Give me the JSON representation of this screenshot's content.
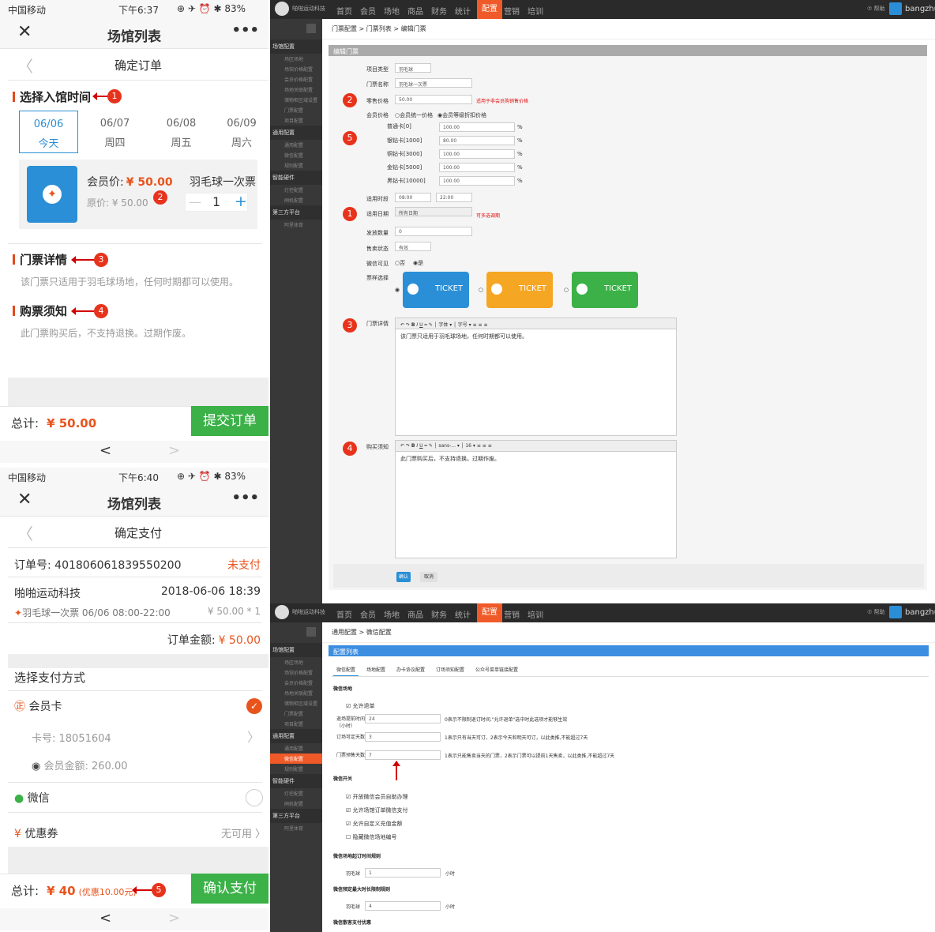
{
  "order_screen": {
    "status": {
      "carrier": "中国移动",
      "time": "下午6:37",
      "icons": "⊕ ✈ ⏰ ✱ 83%"
    },
    "wechat_title": "场馆列表",
    "more": "•••",
    "page_title": "确定订单",
    "choose_time": "选择入馆时间",
    "dates": [
      {
        "d": "06/06",
        "w": "今天"
      },
      {
        "d": "06/07",
        "w": "周四"
      },
      {
        "d": "06/08",
        "w": "周五"
      },
      {
        "d": "06/09",
        "w": "周六"
      }
    ],
    "member_price_label": "会员价:",
    "member_price": "¥ 50.00",
    "orig_price": "原价: ¥ 50.00",
    "ticket_name": "羽毛球一次票",
    "qty": "1",
    "minus": "—",
    "plus": "+",
    "detail_title": "门票详情",
    "detail_text": "该门票只适用于羽毛球场地，任何时期都可以使用。",
    "notice_title": "购票须知",
    "notice_text": "此门票购买后，不支持退换。过期作废。",
    "total_label": "总计:",
    "total": "¥ 50.00",
    "submit": "提交订单"
  },
  "pay_screen": {
    "status": {
      "carrier": "中国移动",
      "time": "下午6:40",
      "icons": "⊕ ✈ ⏰ ✱ 83%"
    },
    "wechat_title": "场馆列表",
    "more": "•••",
    "page_title": "确定支付",
    "order_no": "订单号: 401806061839550200",
    "unpaid": "未支付",
    "company": "啪啪运动科技",
    "datetime": "2018-06-06 18:39",
    "item": "羽毛球一次票 06/06 08:00-22:00",
    "item_price": "¥ 50.00 * 1",
    "amount_label": "订单金额:",
    "amount": "¥ 50.00",
    "pay_method": "选择支付方式",
    "member_card": "会员卡",
    "card_no": "卡号: 18051604",
    "balance": "会员金额: 260.00",
    "wechat": "微信",
    "coupon": "优惠券",
    "coupon_state": "无可用",
    "total_label": "总计:",
    "total": "¥ 40",
    "discount": "(优惠10.00元)",
    "confirm": "确认支付"
  },
  "back": "<",
  "forward": ">",
  "markers": [
    "1",
    "2",
    "3",
    "4",
    "5"
  ],
  "admin": {
    "brand": "啪啪运动科技",
    "nav": [
      "首页",
      "会员",
      "场地",
      "商品",
      "财务",
      "统计",
      "配置",
      "营销",
      "培训"
    ],
    "help": "⑦ 帮助",
    "user": "bangzhu",
    "side_groups": [
      {
        "title": "场馆配置",
        "items": [
          "场区场地",
          "场馆价格配置",
          "会员价格配置",
          "场地关联配置",
          "储物柜区域设置",
          "门票配置",
          "项目配置"
        ]
      },
      {
        "title": "通用配置",
        "items": [
          "通用配置",
          "微信配置",
          "规则配置"
        ]
      },
      {
        "title": "智能硬件",
        "items": [
          "灯控配置",
          "闸机配置"
        ]
      },
      {
        "title": "第三方平台",
        "items": [
          "阿里体育"
        ]
      }
    ],
    "breadcrumb1": "门票配置 > 门票列表 > 编辑门票",
    "panel1_title": "编辑门票",
    "form": {
      "item_type_label": "项目类型",
      "item_type": "羽毛球",
      "ticket_name_label": "门票名称",
      "ticket_name": "羽毛球一次票",
      "price_label": "零售价格",
      "price": "50.00",
      "price_hint": "适用于非会员购销售价格",
      "member_price_label": "会员价格",
      "radio1": "会员统一价格",
      "radio2": "会员等级折扣价格",
      "levels": [
        {
          "n": "普通卡[0]",
          "v": "100.00"
        },
        {
          "n": "银钻卡[1000]",
          "v": "80.00"
        },
        {
          "n": "铜钻卡[3000]",
          "v": "100.00"
        },
        {
          "n": "金钻卡[5000]",
          "v": "100.00"
        },
        {
          "n": "黑钻卡[10000]",
          "v": "100.00"
        }
      ],
      "pct": "%",
      "time_label": "适用时段",
      "time_from": "08:00",
      "time_to": "22:00",
      "date_label": "适用日期",
      "date_val": "所有日期",
      "date_hint": "可多选调期",
      "qty_label": "发放数量",
      "qty_val": "0",
      "status_label": "售卖状态",
      "status_val": "有效",
      "visible_label": "微信可见",
      "no": "否",
      "yes": "是",
      "style_label": "票样选择",
      "ticket_text": "TICKET",
      "ticket_colors": [
        "#2a8fd6",
        "#f5a623",
        "#3bb148"
      ],
      "detail_label": "门票详情",
      "detail_font": "字体",
      "detail_size": "字号",
      "detail_text": "该门票只适用于羽毛球场地，任何时期都可以使用。",
      "notice_label": "购买须知",
      "notice_font": "sans-...",
      "notice_size": "16",
      "notice_text": "此门票购买后，不支持退换。过期作废。",
      "ok": "确认",
      "cancel": "取消"
    },
    "breadcrumb2": "通用配置 > 微信配置",
    "panel2_title": "配置列表",
    "tabs": [
      "微信配置",
      "场地配置",
      "办卡协议配置",
      "订场须知配置",
      "公众号菜单链接配置"
    ],
    "wx": {
      "booking": "微信场地",
      "allow_refund": "允许退单",
      "refund_hours_label": "退场提前时间（小时）",
      "refund_hours": "24",
      "refund_hint": "0表示不限制退订时间,\"允许退单\"选中时此选项才能够生效",
      "book_days_label": "订场可定天数",
      "book_days": "3",
      "book_hint": "1表示只有当天可订，2表示今天和明天可订，以此类推,不能超过7天",
      "ticket_days_label": "门票预售天数",
      "ticket_days": "7",
      "ticket_hint": "1表示只能售卖当天的门票，2表示门票可以提前1天售卖，以此类推,不能超过7天",
      "switch": "微信开关",
      "sw": [
        "开放微信会员自助办理",
        "允许场馆订单微信支付",
        "允许自定义充值金额",
        "隐藏微信场地编号"
      ],
      "sw_checked": [
        true,
        true,
        true,
        false
      ],
      "start_rule": "微信场地起订时间规则",
      "badminton": "羽毛球",
      "v1": "1",
      "hour": "小时",
      "max_rule": "微信预定最大时长限制规则",
      "v2": "4",
      "pay_rule": "微信散客支付优惠"
    }
  }
}
